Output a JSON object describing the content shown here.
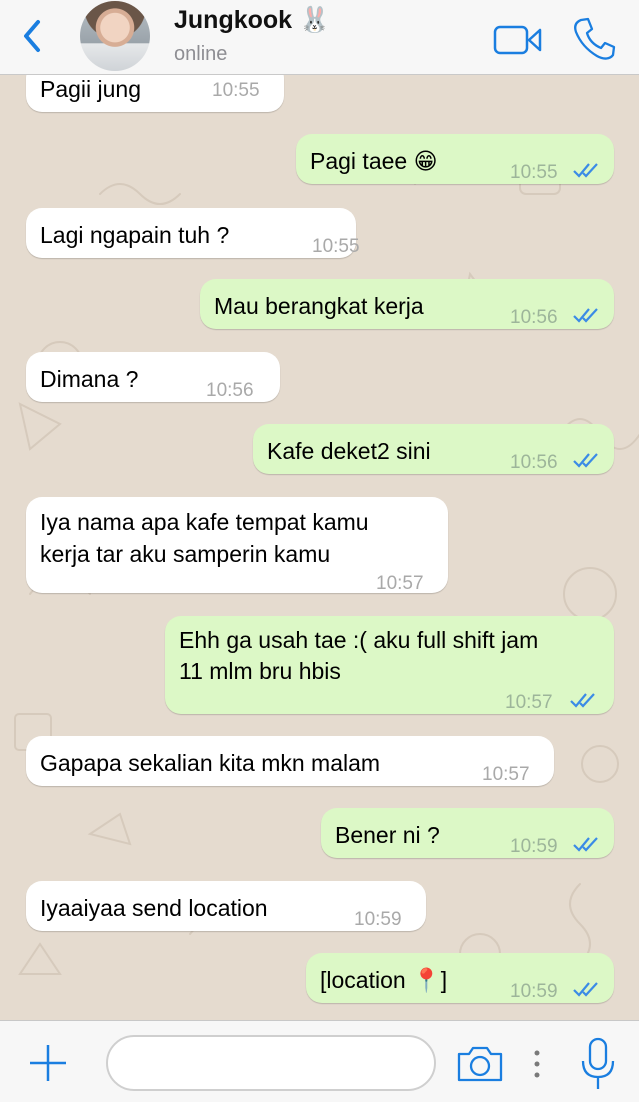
{
  "header": {
    "contact_name": "Jungkook 🐰",
    "status": "online",
    "back_icon": "chevron-left-icon",
    "video_icon": "video-camera-icon",
    "call_icon": "phone-icon",
    "accent_color": "#1a7ee0"
  },
  "messages": [
    {
      "direction": "in",
      "lines": [
        "Pagii jung"
      ],
      "time": "10:55"
    },
    {
      "direction": "out",
      "lines": [
        "Pagi taee 😁"
      ],
      "time": "10:55",
      "read": true
    },
    {
      "direction": "in",
      "lines": [
        "Lagi ngapain tuh ?"
      ],
      "time": "10:55"
    },
    {
      "direction": "out",
      "lines": [
        "Mau berangkat kerja"
      ],
      "time": "10:56",
      "read": true
    },
    {
      "direction": "in",
      "lines": [
        "Dimana ?"
      ],
      "time": "10:56"
    },
    {
      "direction": "out",
      "lines": [
        "Kafe deket2 sini"
      ],
      "time": "10:56",
      "read": true
    },
    {
      "direction": "in",
      "lines": [
        "Iya nama apa kafe tempat kamu",
        "kerja tar aku samperin kamu"
      ],
      "time": "10:57"
    },
    {
      "direction": "out",
      "lines": [
        "Ehh ga usah tae :( aku full shift jam",
        "11 mlm bru hbis"
      ],
      "time": "10:57",
      "read": true
    },
    {
      "direction": "in",
      "lines": [
        "Gapapa sekalian kita mkn malam"
      ],
      "time": "10:57"
    },
    {
      "direction": "out",
      "lines": [
        "Bener ni ?"
      ],
      "time": "10:59",
      "read": true
    },
    {
      "direction": "in",
      "lines": [
        "Iyaaiyaa send location"
      ],
      "time": "10:59"
    },
    {
      "direction": "out",
      "lines": [
        "[location 📍]"
      ],
      "time": "10:59",
      "read": true
    }
  ],
  "colors": {
    "incoming_bubble": "#ffffff",
    "outgoing_bubble": "#dcf8c6",
    "read_ticks": "#3b8be6",
    "chat_background": "#e5dbcf"
  },
  "input_bar": {
    "placeholder": "",
    "plus_icon": "plus-icon",
    "camera_icon": "camera-icon",
    "more_icon": "more-vertical-icon",
    "mic_icon": "microphone-icon"
  }
}
